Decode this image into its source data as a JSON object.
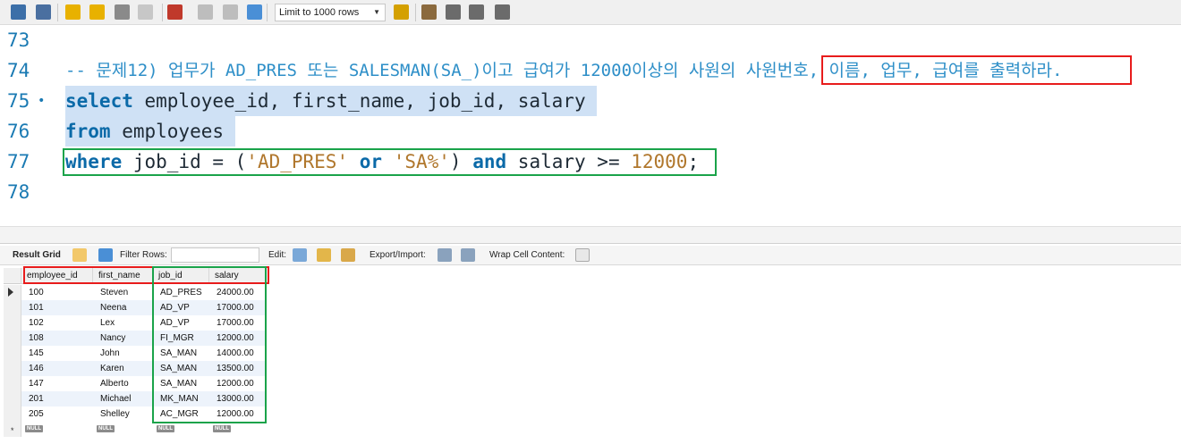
{
  "toolbar": {
    "limit_select": "Limit to 1000 rows",
    "icons": [
      "open-folder-icon",
      "save-icon",
      "execute-icon",
      "execute-current-icon",
      "explain-icon",
      "stop-icon",
      "toggle-error-icon",
      "commit-icon",
      "rollback-icon",
      "autocommit-icon",
      "add-snippet-icon",
      "beautify-icon",
      "find-icon",
      "invisible-chars-icon",
      "wrap-icon"
    ]
  },
  "editor": {
    "lines": [
      {
        "number": "73",
        "parts": []
      },
      {
        "number": "74",
        "parts": [
          {
            "t": "-- 문제12) 업무가 AD_PRES 또는 SALESMAN(SA_)이고 급여가 12000이상의 사원의 사원번호, 이름, 업무, 급여를 출력하라.",
            "c": "cmt"
          }
        ]
      },
      {
        "number": "75",
        "dot": "•",
        "parts": [
          {
            "t": "select",
            "c": "kw"
          },
          {
            "t": " employee_id, first_name, job_id, salary",
            "c": "id"
          }
        ]
      },
      {
        "number": "76",
        "parts": [
          {
            "t": "from",
            "c": "kw"
          },
          {
            "t": " employees",
            "c": "id"
          }
        ]
      },
      {
        "number": "77",
        "parts": [
          {
            "t": "where",
            "c": "kw"
          },
          {
            "t": " job_id = (",
            "c": "id"
          },
          {
            "t": "'AD_PRES'",
            "c": "str"
          },
          {
            "t": " ",
            "c": "id"
          },
          {
            "t": "or",
            "c": "kw"
          },
          {
            "t": " ",
            "c": "id"
          },
          {
            "t": "'SA%'",
            "c": "str"
          },
          {
            "t": ") ",
            "c": "id"
          },
          {
            "t": "and",
            "c": "kw"
          },
          {
            "t": " salary >= ",
            "c": "id"
          },
          {
            "t": "12000",
            "c": "num"
          },
          {
            "t": ";",
            "c": "id"
          }
        ]
      },
      {
        "number": "78",
        "parts": []
      }
    ]
  },
  "result_toolbar": {
    "result_grid": "Result Grid",
    "filter_rows": "Filter Rows:",
    "edit": "Edit:",
    "export_import": "Export/Import:",
    "wrap_cell": "Wrap Cell Content:"
  },
  "grid": {
    "columns": [
      "employee_id",
      "first_name",
      "job_id",
      "salary"
    ],
    "rows": [
      [
        "100",
        "Steven",
        "AD_PRES",
        "24000.00"
      ],
      [
        "101",
        "Neena",
        "AD_VP",
        "17000.00"
      ],
      [
        "102",
        "Lex",
        "AD_VP",
        "17000.00"
      ],
      [
        "108",
        "Nancy",
        "FI_MGR",
        "12000.00"
      ],
      [
        "145",
        "John",
        "SA_MAN",
        "14000.00"
      ],
      [
        "146",
        "Karen",
        "SA_MAN",
        "13500.00"
      ],
      [
        "147",
        "Alberto",
        "SA_MAN",
        "12000.00"
      ],
      [
        "201",
        "Michael",
        "MK_MAN",
        "13000.00"
      ],
      [
        "205",
        "Shelley",
        "AC_MGR",
        "12000.00"
      ]
    ],
    "null_label": "NULL",
    "new_row_marker": "*"
  },
  "colors": {
    "highlight_red": "#e81c1c",
    "highlight_green": "#1aa34a",
    "selection": "#cfe1f5",
    "keyword": "#0b6aa8",
    "string": "#b0772c"
  }
}
